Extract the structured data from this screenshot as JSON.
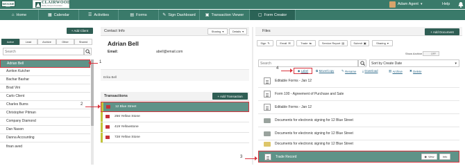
{
  "topbar": {
    "logo_text": "NEXONE",
    "logo_sub": "AGENT",
    "brand_title": "CLAIRWOOD",
    "brand_sub": "Realty Group & Associates",
    "user_name": "Adam Agent",
    "user_caret": "▾",
    "help_label": "Help",
    "bell_icon": "bell-icon"
  },
  "nav": {
    "items": [
      {
        "label": "Home",
        "icon": "home-icon"
      },
      {
        "label": "Calendar",
        "icon": "calendar-icon"
      },
      {
        "label": "Activities",
        "icon": "activities-icon"
      },
      {
        "label": "Forms",
        "icon": "forms-icon"
      },
      {
        "label": "Sign Dashboard",
        "icon": "sign-icon"
      },
      {
        "label": "Transaction Viewer",
        "icon": "transaction-icon"
      },
      {
        "label": "Form Creator",
        "icon": "form-creator-icon"
      }
    ]
  },
  "left": {
    "add_client_label": "+ Add Client",
    "tabs": [
      "Active",
      "Lead",
      "Archive",
      "Other",
      "Shared"
    ],
    "search_placeholder": "Search",
    "contacts": [
      "Adrian Bell",
      "Azriton Kutcher",
      "Bachar Bashar",
      "Brad Vini",
      "Carlo Client",
      "Charles Burns",
      "Christopher Pitman",
      "Company Diamond",
      "Dan Nason",
      "Danna Accounting",
      "finan aved"
    ]
  },
  "middle": {
    "header": "Contact Info",
    "sharing_label": "Sharing",
    "details_label": "Details",
    "contact_name": "Adrian Bell",
    "email_label": "Email:",
    "email_value": "abell@email.com",
    "secondary_name": "Erika Bell",
    "transactions_label": "Transactions",
    "add_transaction_label": "+ Add Transaction",
    "transactions": [
      "12 Blue Street",
      "256 Yellow Stone",
      "419 Yellowstone",
      "728 Yellow Stone"
    ]
  },
  "right": {
    "header": "Files",
    "add_document_label": "+ Add Document",
    "toolbar": [
      "Sign",
      "Email",
      "Trade",
      "Service Report",
      "Submit",
      "Sharing"
    ],
    "show_archive_label": "Show Archive",
    "toggle_label": "OFF",
    "search_placeholder": "Search",
    "sort_label": "Sort by Create Date",
    "actions": [
      "Label",
      "Move/Copy",
      "Rename",
      "Download",
      "Archive",
      "Delete"
    ],
    "files": [
      {
        "name": "Editable Forms - Jan 12",
        "icon": "document-icon"
      },
      {
        "name": "Form 100 - Agreement of Purchase and Sale",
        "icon": "document-icon"
      },
      {
        "name": "Editable Forms - Jan 12",
        "icon": "document-icon"
      },
      {
        "name": "Documents for electronic signing for 12 Blue Street",
        "icon": "folder-grey-icon"
      },
      {
        "name": "Documents for electronic signing for 12 Blue Street",
        "icon": "folder-grey-icon"
      },
      {
        "name": "Documents for electronic signing for 12 Blue Street",
        "icon": "folder-yellow-icon"
      }
    ],
    "trade_record": "Trade Record",
    "view_label": "View",
    "info_label": "Info"
  },
  "annotations": [
    "1",
    "2",
    "3",
    "4"
  ],
  "colors": {
    "brand_green": "#3a7a6a",
    "dark_green": "#2f5e54",
    "selected_row": "#5f9388",
    "highlight_red": "#d9343e"
  }
}
